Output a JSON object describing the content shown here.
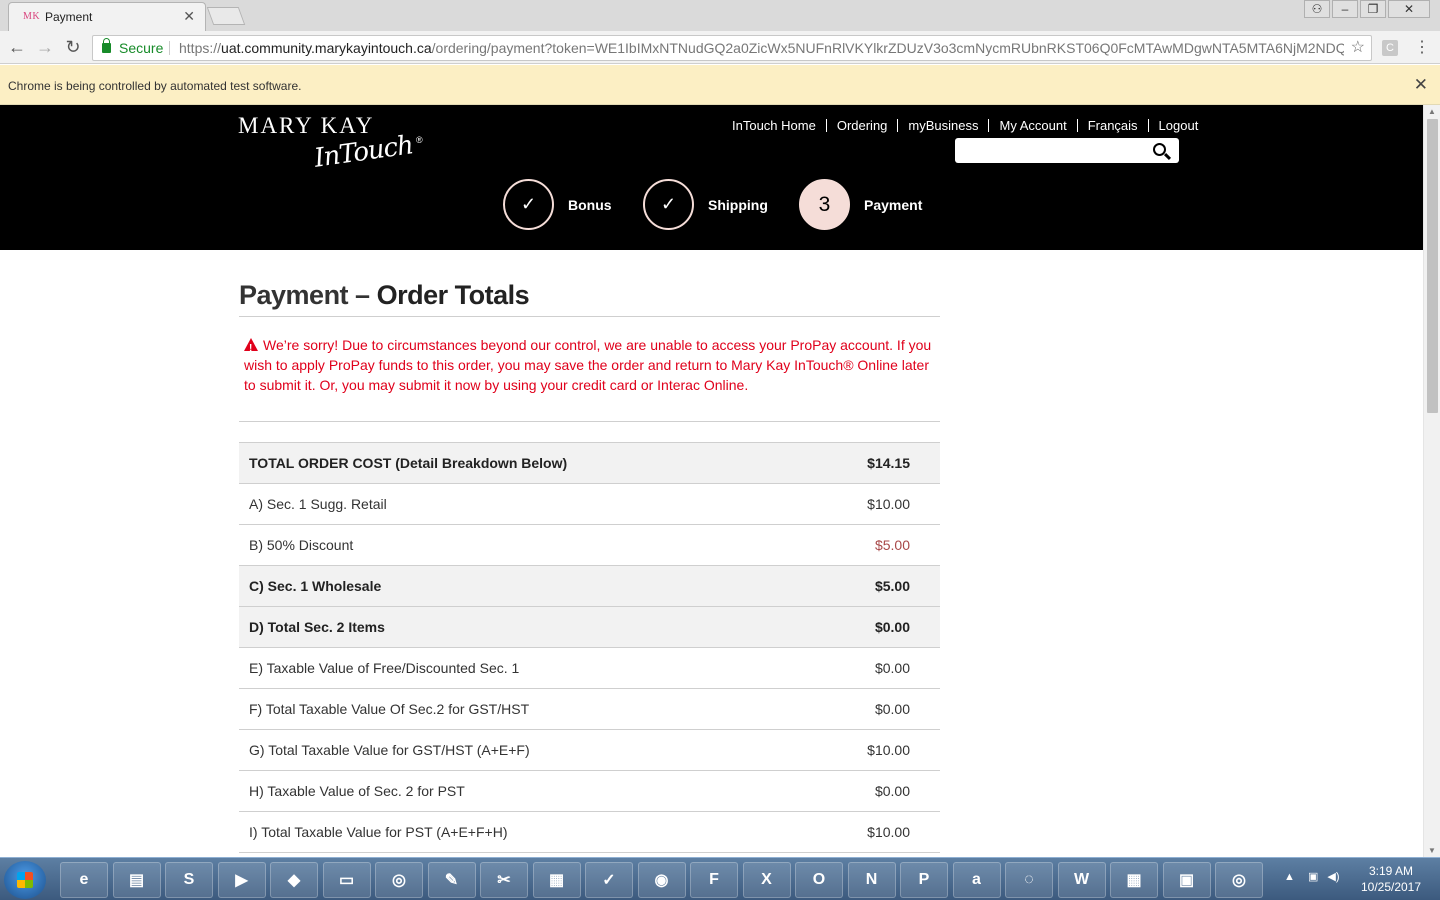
{
  "browser": {
    "tab_title": "Payment",
    "tab_favicon": "MK",
    "url_scheme": "https://",
    "url_host": "uat.community.marykayintouch.ca",
    "url_rest": "/ordering/payment?token=WE1IbIMxNTNudGQ2a0ZicWx5NUFnRlVKYlkrZDUzV3o3cmNycmRUbnRKST06Q0FcMTAwMDgwNTA5MTA6NjM2NDQ...",
    "secure_label": "Secure",
    "infobar_text": "Chrome is being controlled by automated test software."
  },
  "site": {
    "logo_top": "MARY KAY",
    "logo_script": "InTouch",
    "logo_reg": "®",
    "nav": [
      "InTouch Home",
      "Ordering",
      "myBusiness",
      "My Account",
      "Français",
      "Logout"
    ],
    "steps": [
      {
        "label": "Bonus",
        "marker": "✓"
      },
      {
        "label": "Shipping",
        "marker": "✓"
      },
      {
        "label": "Payment",
        "marker": "3"
      }
    ]
  },
  "page": {
    "title_light": "Payment – ",
    "title_bold": "Order Totals",
    "error": "We’re sorry! Due to circumstances beyond our control, we are unable to access your ProPay account. If you wish to apply ProPay funds to this order, you may save the order and return to Mary Kay InTouch® Online later to submit it. Or, you may submit it now by using your credit card or Interac Online.",
    "totals": [
      {
        "label": "TOTAL ORDER COST (Detail Breakdown Below)",
        "amount": "$14.15",
        "bold": true,
        "shade": true,
        "neg": false
      },
      {
        "label": "A) Sec. 1 Sugg. Retail",
        "amount": "$10.00",
        "bold": false,
        "shade": false,
        "neg": false
      },
      {
        "label": "B) 50% Discount",
        "amount": "$5.00",
        "bold": false,
        "shade": false,
        "neg": true
      },
      {
        "label": "C) Sec. 1 Wholesale",
        "amount": "$5.00",
        "bold": true,
        "shade": true,
        "neg": false
      },
      {
        "label": "D) Total Sec. 2 Items",
        "amount": "$0.00",
        "bold": true,
        "shade": true,
        "neg": false
      },
      {
        "label": "E) Taxable Value of Free/Discounted Sec. 1",
        "amount": "$0.00",
        "bold": false,
        "shade": false,
        "neg": false
      },
      {
        "label": "F) Total Taxable Value Of Sec.2 for GST/HST",
        "amount": "$0.00",
        "bold": false,
        "shade": false,
        "neg": false
      },
      {
        "label": "G) Total Taxable Value for GST/HST (A+E+F)",
        "amount": "$10.00",
        "bold": false,
        "shade": false,
        "neg": false
      },
      {
        "label": "H) Taxable Value of Sec. 2 for PST",
        "amount": "$0.00",
        "bold": false,
        "shade": false,
        "neg": false
      },
      {
        "label": "I) Total Taxable Value for PST (A+E+F+H)",
        "amount": "$10.00",
        "bold": false,
        "shade": false,
        "neg": false
      }
    ]
  },
  "taskbar": {
    "apps": [
      "ie-icon",
      "explorer-icon",
      "skype-icon",
      "visual-studio-icon",
      "app-icon",
      "sticky-notes-icon",
      "chrome-icon",
      "paint-icon",
      "tool-icon",
      "snipping-icon",
      "notepad-icon",
      "firefox-icon",
      "app-f-icon",
      "excel-icon",
      "outlook-icon",
      "onenote-icon",
      "powerpoint-icon",
      "amazon-icon",
      "app-circle-icon",
      "word-icon",
      "calculator-icon",
      "window-icon",
      "chrome-active-icon"
    ],
    "app_glyphs": [
      "e",
      "▤",
      "S",
      "▶",
      "◆",
      "▭",
      "◎",
      "✎",
      "✂",
      "▦",
      "✓",
      "◉",
      "F",
      "X",
      "O",
      "N",
      "P",
      "a",
      "◌",
      "W",
      "▦",
      "▣",
      "◎"
    ],
    "time": "3:19 AM",
    "date": "10/25/2017"
  }
}
